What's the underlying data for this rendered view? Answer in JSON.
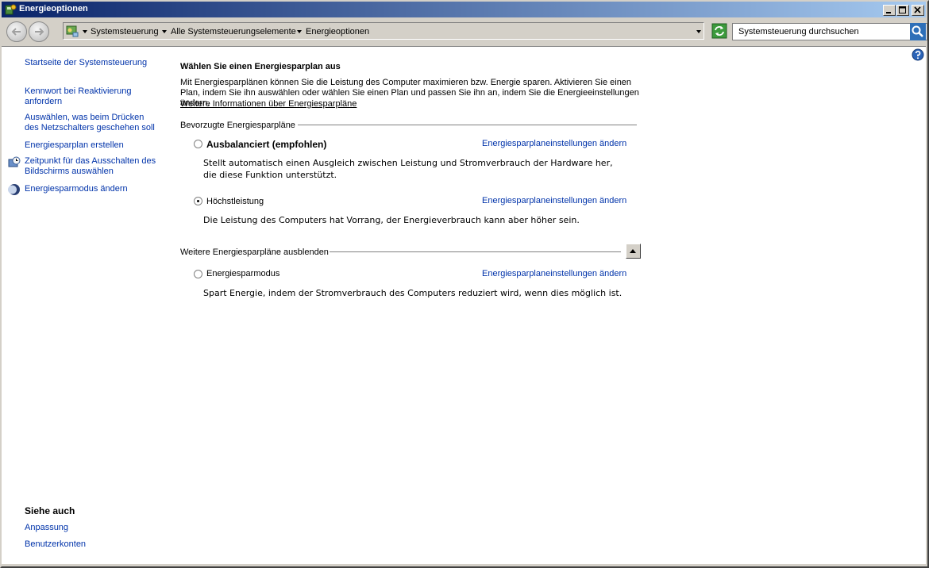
{
  "window": {
    "title": "Energieoptionen",
    "buttons": {
      "minimize": "minimize",
      "maximize": "maximize",
      "close": "close"
    }
  },
  "address": {
    "breadcrumbs": [
      "Systemsteuerung",
      "Alle Systemsteuerungselemente",
      "Energieoptionen"
    ]
  },
  "search": {
    "placeholder": "Systemsteuerung durchsuchen"
  },
  "sidebar": {
    "items": [
      {
        "label": "Startseite der Systemsteuerung",
        "icon": ""
      },
      {
        "label": "Kennwort bei Reaktivierung anfordern",
        "icon": ""
      },
      {
        "label": "Auswählen, was beim Drücken des Netzschalters geschehen soll",
        "icon": ""
      },
      {
        "label": "Energiesparplan erstellen",
        "icon": ""
      },
      {
        "label": "Zeitpunkt für das Ausschalten des Bildschirms auswählen",
        "icon": "clock-monitor-icon"
      },
      {
        "label": "Energiesparmodus ändern",
        "icon": "moon-icon"
      }
    ],
    "see_also": {
      "title": "Siehe auch",
      "items": [
        "Anpassung",
        "Benutzerkonten"
      ]
    }
  },
  "main": {
    "title": "Wählen Sie einen Energiesparplan aus",
    "description": "Mit Energiesparplänen können Sie die Leistung des Computer maximieren bzw. Energie sparen. Aktivieren Sie einen Plan, indem Sie ihn auswählen oder wählen Sie einen Plan und passen Sie ihn an, indem Sie die Energieeinstellungen ändern.",
    "more_info": "Weitere Informationen über Energiesparpläne",
    "preferred_header": "Bevorzugte Energiesparpläne",
    "plans": [
      {
        "name": "Ausbalanciert (empfohlen)",
        "selected": false,
        "link": "Energiesparplaneinstellungen ändern",
        "description": "Stellt automatisch einen Ausgleich zwischen Leistung und Stromverbrauch der Hardware her, die diese Funktion unterstützt."
      },
      {
        "name": "Höchstleistung",
        "selected": true,
        "link": "Energiesparplaneinstellungen ändern",
        "description": "Die Leistung des Computers hat Vorrang, der Energieverbrauch kann aber höher sein."
      }
    ],
    "more_header": "Weitere Energiesparpläne ausblenden",
    "more_plans": [
      {
        "name": "Energiesparmodus",
        "selected": false,
        "link": "Energiesparplaneinstellungen ändern",
        "description": "Spart Energie, indem der Stromverbrauch des Computers reduziert wird, wenn dies möglich ist."
      }
    ]
  },
  "colors": {
    "link": "#0033aa",
    "title_gradient_start": "#0a246a",
    "title_gradient_end": "#a6caf0",
    "chrome": "#d4d0c8"
  }
}
